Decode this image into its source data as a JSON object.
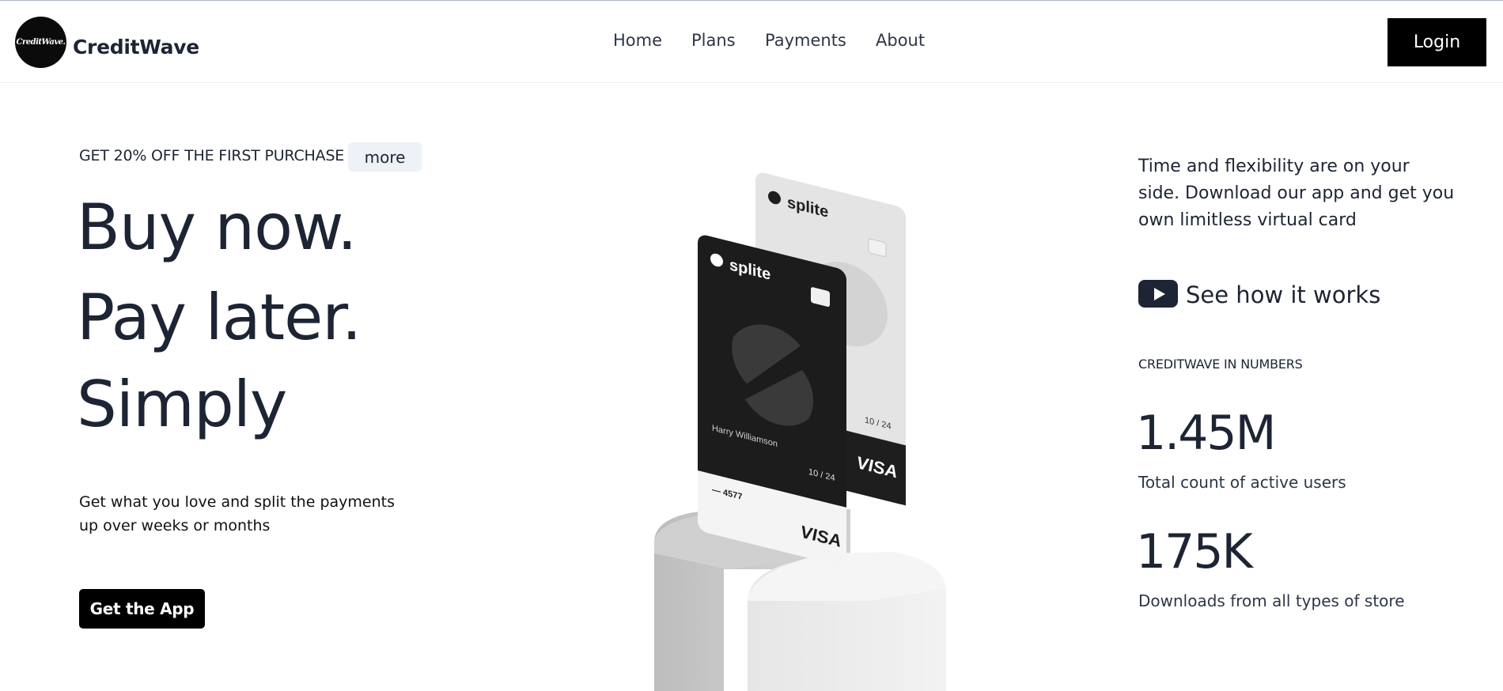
{
  "header": {
    "logo_text": "CreditWave.",
    "brand": "CreditWave",
    "nav": [
      {
        "label": "Home"
      },
      {
        "label": "Plans"
      },
      {
        "label": "Payments"
      },
      {
        "label": "About"
      }
    ],
    "login_label": "Login"
  },
  "hero": {
    "promo": "GET 20% OFF THE FIRST PURCHASE",
    "more_label": "more",
    "line1": "Buy now.",
    "line2": "Pay later.",
    "line3": "Simply",
    "subtitle": "Get what you love and split the payments up over weeks or months",
    "cta_label": "Get the App"
  },
  "cards": {
    "brand": "splite",
    "front_name": "Harry Williamson",
    "front_number": "— 4577",
    "expiry": "10 / 24",
    "network": "VISA"
  },
  "right": {
    "tagline": "Time and flexibility are on your side. Download our app and get you own limitless virtual card",
    "how_label": "See how it works",
    "numbers_heading": "CREDITWAVE IN NUMBERS",
    "stats": [
      {
        "value": "1.45M",
        "label": "Total count of active users"
      },
      {
        "value": "175K",
        "label": "Downloads from all types of store"
      }
    ]
  },
  "colors": {
    "text": "#1d2433",
    "button": "#000000",
    "chip_bg": "#eef2f6",
    "card_dark": "#1c1c1c",
    "card_light": "#e4e4e4"
  }
}
